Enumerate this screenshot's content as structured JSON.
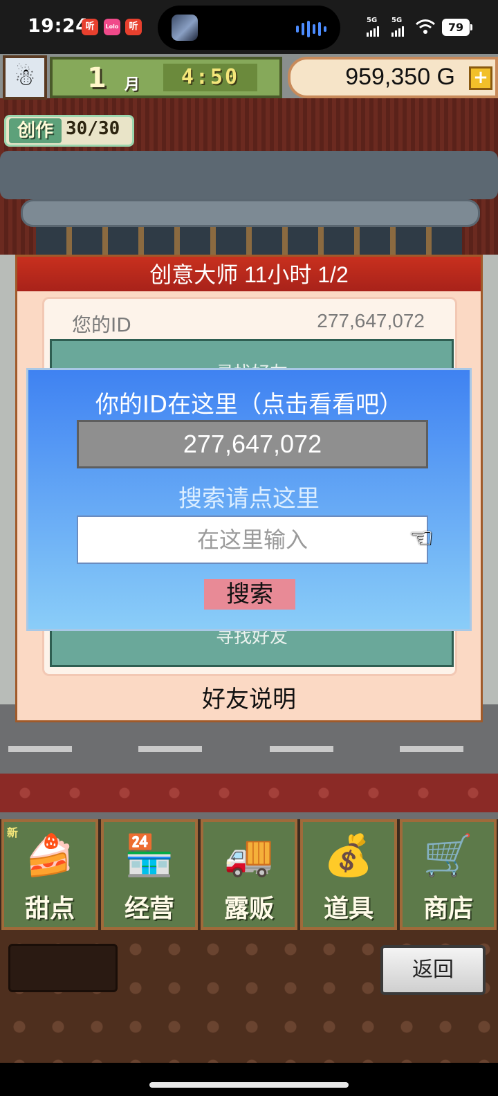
{
  "status_bar": {
    "time": "19:24",
    "notifications": [
      {
        "label": "听",
        "color": "#e8402e"
      },
      {
        "label": "Lolo",
        "color": "#f04a8a"
      },
      {
        "label": "听",
        "color": "#e8402e"
      }
    ],
    "signal_1": "5G",
    "signal_2": "5G",
    "battery": "79"
  },
  "hud": {
    "month_number": "1",
    "month_label": "月",
    "clock": "4:50",
    "gold": "959,350 G",
    "gold_plus": "+",
    "craft_label": "创作",
    "craft_count": "30/30"
  },
  "panel": {
    "title": "创意大师  11小时 1/2",
    "your_id_label": "您的ID",
    "your_id_value": "277,647,072",
    "green_top_text": "寻找好友",
    "green_bottom_text": "寻找好友",
    "friend_help": "好友说明"
  },
  "dialog": {
    "title": "你的ID在这里（点击看看吧）",
    "id_value": "277,647,072",
    "search_label": "搜索请点这里",
    "search_placeholder": "在这里输入",
    "search_button": "搜索"
  },
  "menu": {
    "items": [
      {
        "label": "甜点",
        "icon": "cake-icon",
        "glyph": "🍰",
        "badge": "新"
      },
      {
        "label": "经营",
        "icon": "shop-icon",
        "glyph": "🏪"
      },
      {
        "label": "露贩",
        "icon": "food-truck-icon",
        "glyph": "🚚"
      },
      {
        "label": "道具",
        "icon": "item-bag-icon",
        "glyph": "💰"
      },
      {
        "label": "商店",
        "icon": "cart-icon",
        "glyph": "🛒"
      }
    ]
  },
  "footer": {
    "back_label": "返回"
  }
}
